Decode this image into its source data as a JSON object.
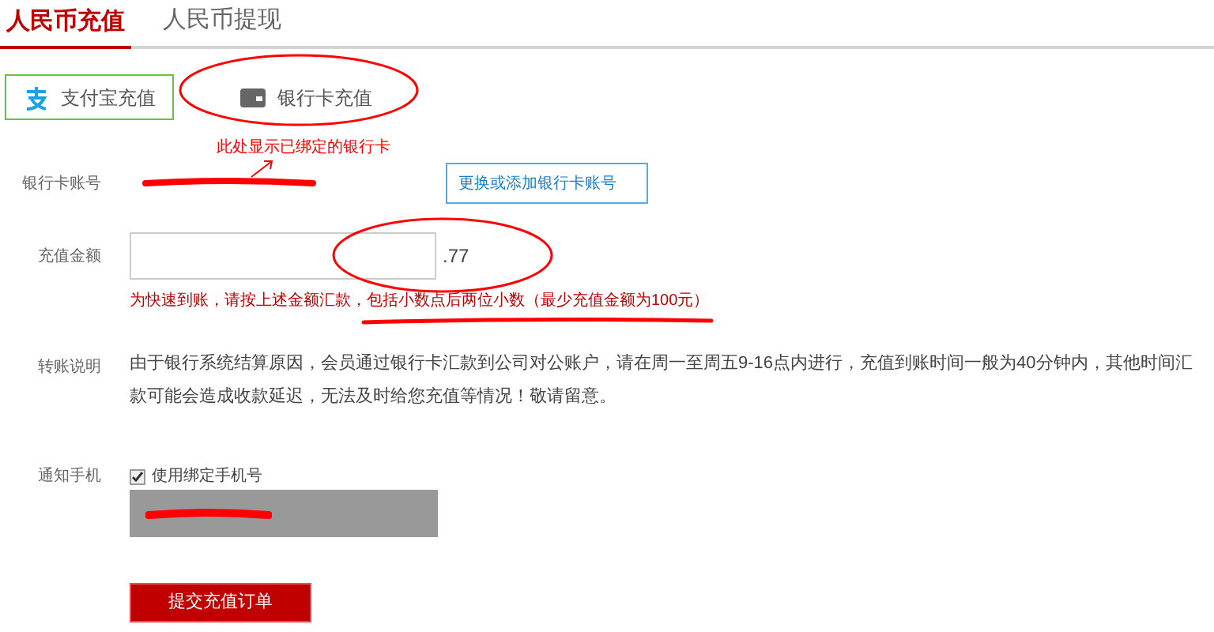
{
  "tabs": [
    {
      "label": "人民币充值",
      "selected": true
    },
    {
      "label": "人民币提现",
      "selected": false
    }
  ],
  "methods": [
    {
      "label": "支付宝充值",
      "kind": "alipay",
      "selected": true
    },
    {
      "label": "银行卡充值",
      "kind": "card",
      "selected": false
    }
  ],
  "annotation": {
    "text": "此处显示已绑定的银行卡"
  },
  "card_row": {
    "label": "银行卡账号",
    "button": "更换或添加银行卡账号"
  },
  "amount_row": {
    "label": "充值金额",
    "suffix": ".77",
    "hint": "为快速到账，请按上述金额汇款，包括小数点后两位小数（最少充值金额为100元）"
  },
  "note_row": {
    "label": "转账说明",
    "text": "由于银行系统结算原因，会员通过银行卡汇款到公司对公账户，请在周一至周五9-16点内进行，充值到账时间一般为40分钟内，其他时间汇款可能会造成收款延迟，无法及时给您充值等情况！敬请留意。"
  },
  "phone_row": {
    "label": "通知手机",
    "checkbox": {
      "label": "使用绑定手机号",
      "checked": true
    }
  },
  "submit": "提交充值订单"
}
